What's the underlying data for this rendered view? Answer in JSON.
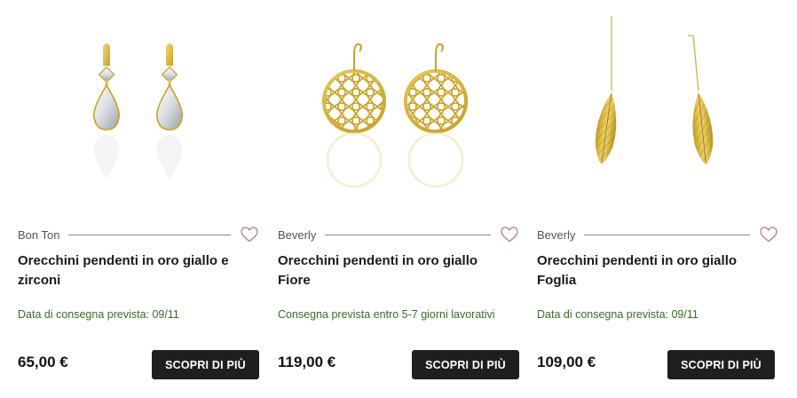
{
  "products": [
    {
      "brand": "Bon Ton",
      "title": "Orecchini pendenti in oro giallo e zirconi",
      "delivery": "Data di consegna prevista: 09/11",
      "price": "65,00 €",
      "cta": "SCOPRI DI PIÙ",
      "image": "drop-earrings-zirconia"
    },
    {
      "brand": "Beverly",
      "title": "Orecchini pendenti in oro giallo Fiore",
      "delivery": "Consegna prevista entro 5-7 giorni lavorativi",
      "price": "119,00 €",
      "cta": "SCOPRI DI PIÙ",
      "image": "round-filigree-earrings"
    },
    {
      "brand": "Beverly",
      "title": "Orecchini pendenti in oro giallo Foglia",
      "delivery": "Data di consegna prevista: 09/11",
      "price": "109,00 €",
      "cta": "SCOPRI DI PIÙ",
      "image": "feather-threader-earrings"
    }
  ],
  "colors": {
    "gold": "#d8b432",
    "gold_dark": "#b8931c",
    "heart": "#c08a95",
    "delivery_text": "#3a6b2c",
    "button_bg": "#1f1f1f"
  },
  "icons": {
    "wishlist": "heart-outline-icon"
  }
}
